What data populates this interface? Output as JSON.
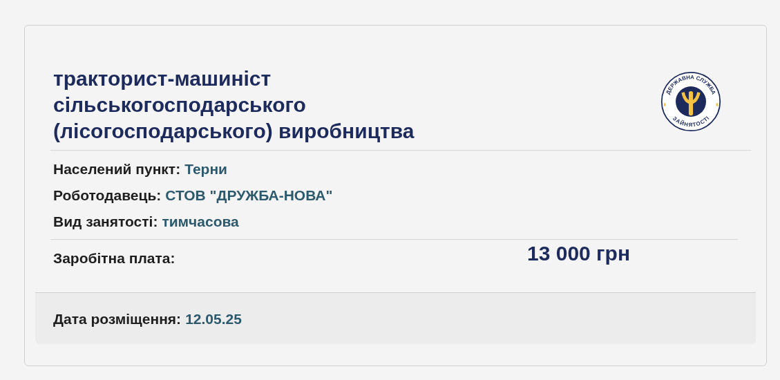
{
  "vacancy": {
    "title": "тракторист-машиніст сільськогосподарського (лісогосподарського) виробництва",
    "logo": {
      "top_text": "ДЕРЖАВНА СЛУЖБА",
      "bottom_text": "ЗАЙНЯТОСТІ"
    },
    "details": [
      {
        "label": "Населений пункт:",
        "value": "Терни"
      },
      {
        "label": "Роботодавець:",
        "value": "СТОВ \"ДРУЖБА-НОВА\""
      },
      {
        "label": "Вид занятості:",
        "value": "тимчасова"
      }
    ],
    "salary": {
      "label": "Заробітна плата:",
      "value": "13 000 грн"
    },
    "footer": {
      "label": "Дата розміщення:",
      "value": "12.05.25"
    }
  }
}
